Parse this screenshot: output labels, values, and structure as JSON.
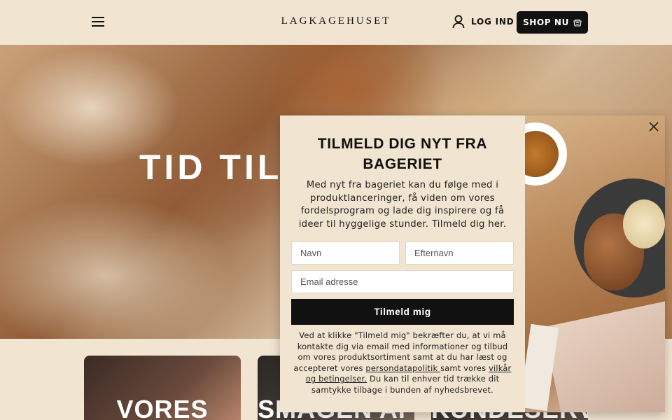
{
  "header": {
    "logo": "LAGKAGEHUSET",
    "login_label": "LOG IND",
    "shop_label": "SHOP NU"
  },
  "hero": {
    "title": "TID TIL"
  },
  "cards": [
    {
      "title": "VORES"
    },
    {
      "title": "SMAGEN AF"
    },
    {
      "title": "KUNDESERV"
    }
  ],
  "modal": {
    "title": "TILMELD DIG NYT FRA BAGERIET",
    "description": "Med nyt fra bageriet kan du følge med i produktlanceringer, få viden om vores fordelsprogram og lade dig inspirere og få ideer til hyggelige stunder. Tilmeld dig her.",
    "first_name_placeholder": "Navn",
    "last_name_placeholder": "Efternavn",
    "email_placeholder": "Email adresse",
    "submit_label": "Tilmeld mig",
    "legal_text_1": "Ved at klikke \"Tilmeld mig\" bekræfter du, at vi må kontakte dig via email med informationer og tilbud om vores produktsortiment samt at du har læst og accepteret vores ",
    "privacy_link": "persondatapolitik ",
    "legal_text_2": "samt vores ",
    "terms_link": "vilkår og betingelser.",
    "legal_text_3": " Du kan til enhver tid trække dit samtykke tilbage i bunden af nyhedsbrevet."
  },
  "icons": {
    "menu": "menu-icon",
    "user": "user-icon",
    "shop": "shop-icon",
    "close": "close-icon"
  }
}
